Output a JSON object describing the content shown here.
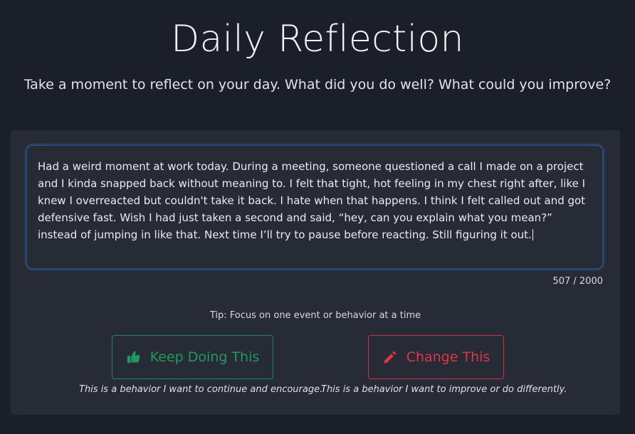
{
  "header": {
    "title": "Daily Reflection",
    "subtitle": "Take a moment to reflect on your day. What did you do well? What could you improve?"
  },
  "reflection": {
    "text": "Had a weird moment at work today. During a meeting, someone questioned a call I made on a project and I kinda snapped back without meaning to. I felt that tight, hot feeling in my chest right after, like I knew I overreacted but couldn't take it back. I hate when that happens. I think I felt called out and got defensive fast. Wish I had just taken a second and said, “hey, can you explain what you mean?” instead of jumping in like that. Next time I’ll try to pause before reacting. Still figuring it out.",
    "char_count": "507 / 2000"
  },
  "tip": "Tip: Focus on one event or behavior at a time",
  "actions": {
    "keep": {
      "label": "Keep Doing This",
      "icon": "thumbs-up-icon",
      "caption": "This is a behavior I want to continue and encourage.",
      "color": "#1f9a5e"
    },
    "change": {
      "label": "Change This",
      "icon": "pencil-icon",
      "caption": "This is a behavior I want to improve or do differently.",
      "color": "#de3646"
    }
  },
  "colors": {
    "background": "#1b1f29",
    "card": "#272b36",
    "focus_border": "#2c4a7c"
  }
}
